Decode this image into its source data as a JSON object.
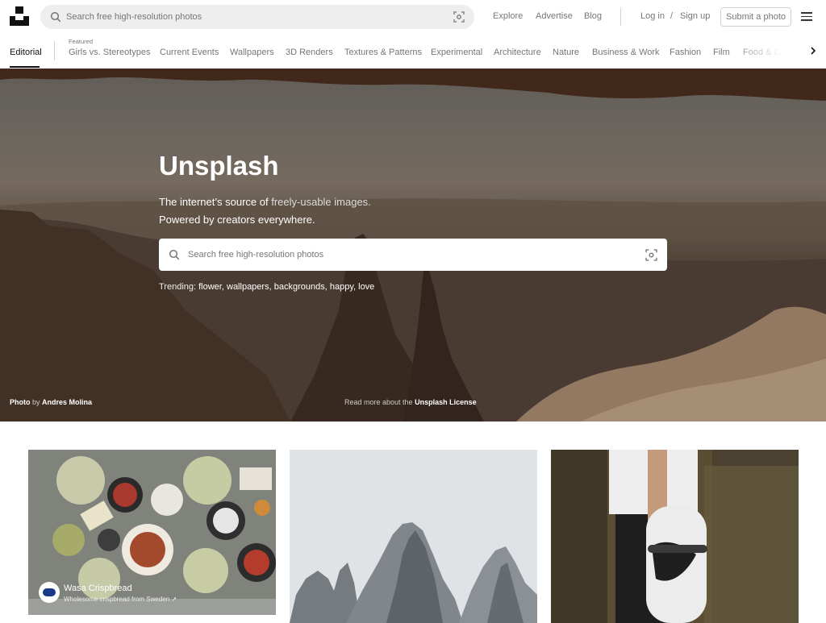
{
  "header": {
    "search_placeholder": "Search free high-resolution photos",
    "nav": [
      "Explore",
      "Advertise",
      "Blog"
    ],
    "login": "Log in",
    "slash": "/",
    "signup": "Sign up",
    "submit": "Submit a photo"
  },
  "topics": {
    "editorial": "Editorial",
    "featured_label": "Featured",
    "items": [
      "Girls vs. Stereotypes",
      "Current Events",
      "Wallpapers",
      "3D Renders",
      "Textures & Patterns",
      "Experimental",
      "Architecture",
      "Nature",
      "Business & Work",
      "Fashion",
      "Film",
      "Food & Drink"
    ]
  },
  "hero": {
    "title": "Unsplash",
    "sub_line1_a": "The internet’s source of ",
    "sub_line1_b": "freely-usable images.",
    "sub_line2": "Powered by creators everywhere.",
    "search_placeholder": "Search free high-resolution photos",
    "trending_label": "Trending:",
    "trending": [
      "flower",
      "wallpapers",
      "backgrounds",
      "happy",
      "love"
    ],
    "credit_prefix": "Photo",
    "credit_by": "by",
    "credit_name": "Andres Molina",
    "license_prefix": "Read more about the",
    "license_link": "Unsplash License"
  },
  "photos": {
    "sponsor_name": "Wasa Crispbread",
    "sponsor_sub": "Wholesome crispbread from Sweden ↗"
  },
  "icons": {
    "logo": "unsplash-logo",
    "search": "search-icon",
    "visual_search": "visual-search-icon",
    "menu": "hamburger-menu-icon",
    "chevron": "chevron-right-icon"
  },
  "colors": {
    "text_primary": "#111111",
    "text_muted": "#767676",
    "search_bg": "#eeeeee",
    "border": "#d1d1d1"
  }
}
